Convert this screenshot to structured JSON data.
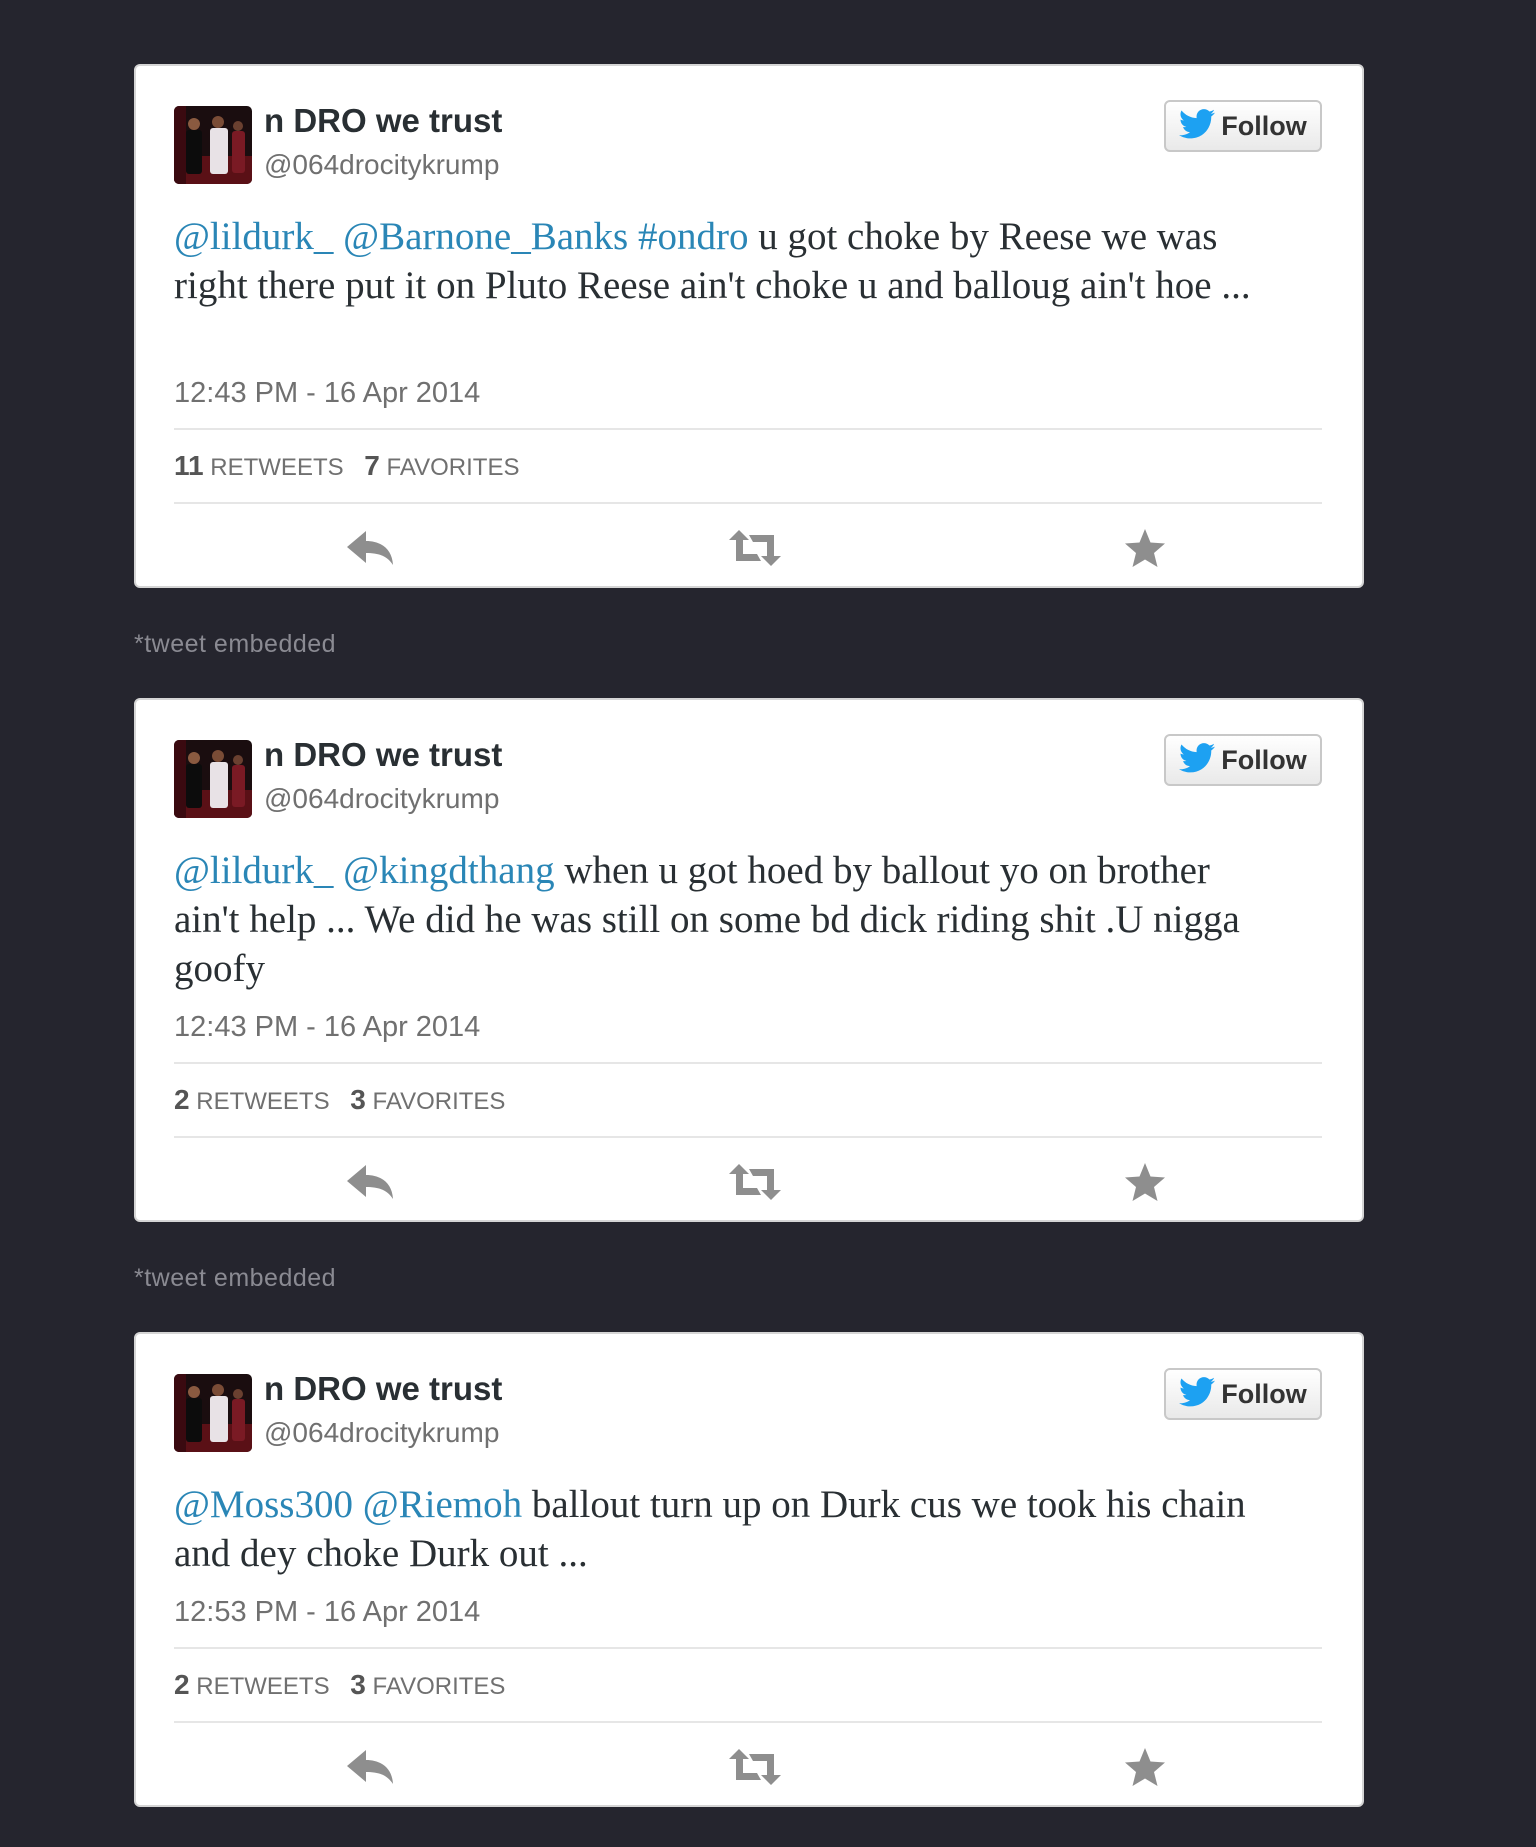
{
  "follow_label": "Follow",
  "embed_note": "*tweet embedded",
  "tweets": [
    {
      "display_name": "n DRO we trust",
      "screen_name": "@064drocitykrump",
      "text": [
        {
          "type": "link",
          "text": "@lildurk_"
        },
        {
          "type": "text",
          "text": " "
        },
        {
          "type": "link",
          "text": "@Barnone_Banks"
        },
        {
          "type": "text",
          "text": "  "
        },
        {
          "type": "link",
          "text": "#ondro"
        },
        {
          "type": "text",
          "text": " u got choke by Reese we was right there put it on Pluto Reese ain't choke u and balloug ain't hoe ..."
        }
      ],
      "timestamp": "12:43 PM - 16 Apr 2014",
      "retweets": "11",
      "retweets_label": "RETWEETS",
      "favorites": "7",
      "favorites_label": "FAVORITES"
    },
    {
      "display_name": "n DRO we trust",
      "screen_name": "@064drocitykrump",
      "text": [
        {
          "type": "link",
          "text": "@lildurk_"
        },
        {
          "type": "text",
          "text": " "
        },
        {
          "type": "link",
          "text": "@kingdthang"
        },
        {
          "type": "text",
          "text": " when u got hoed by ballout yo on brother ain't help ... We did he was still on some bd dick riding shit .U nigga goofy"
        }
      ],
      "timestamp": "12:43 PM - 16 Apr 2014",
      "retweets": "2",
      "retweets_label": "RETWEETS",
      "favorites": "3",
      "favorites_label": "FAVORITES"
    },
    {
      "display_name": "n DRO we trust",
      "screen_name": "@064drocitykrump",
      "text": [
        {
          "type": "link",
          "text": "@Moss300"
        },
        {
          "type": "text",
          "text": " "
        },
        {
          "type": "link",
          "text": "@Riemoh"
        },
        {
          "type": "text",
          "text": " ballout turn up on Durk cus we took his chain and dey choke Durk out ..."
        }
      ],
      "timestamp": "12:53 PM - 16 Apr 2014",
      "retweets": "2",
      "retweets_label": "RETWEETS",
      "favorites": "3",
      "favorites_label": "FAVORITES"
    }
  ],
  "colors": {
    "background": "#25252e",
    "link": "#2a86b6",
    "bird": "#1da1f2",
    "action_icon": "#8e8e8e"
  },
  "icons": {
    "follow": "twitter-bird-icon",
    "reply": "reply-icon",
    "retweet": "retweet-icon",
    "favorite": "star-icon"
  }
}
